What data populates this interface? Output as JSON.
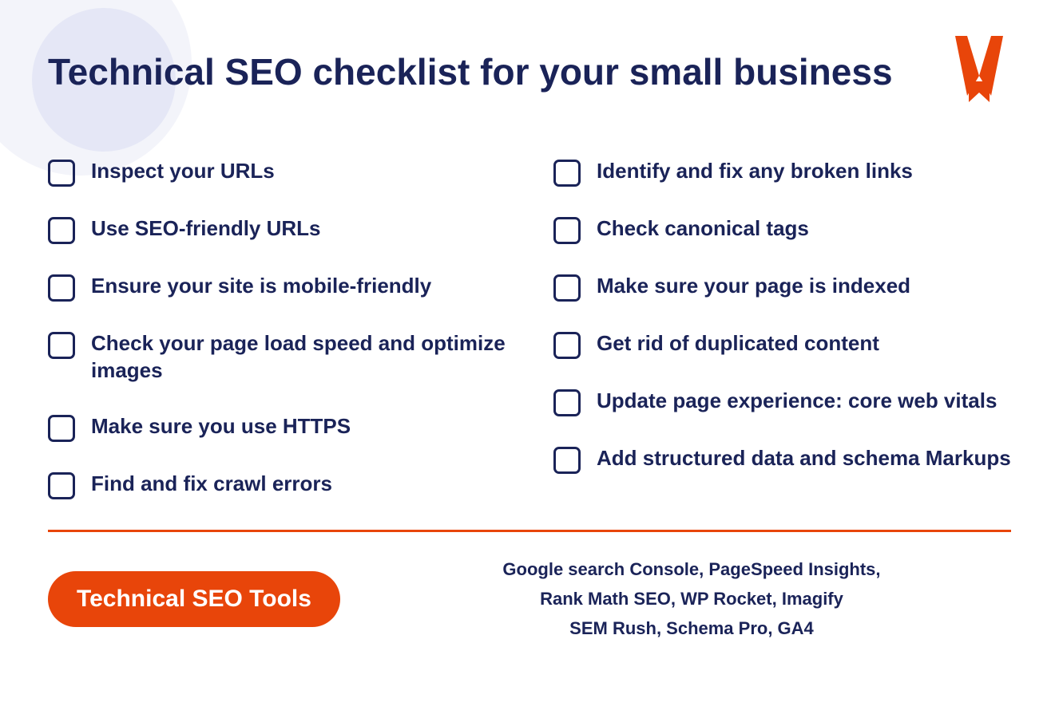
{
  "page": {
    "title": "Technical SEO checklist for your small business",
    "logo_alt": "W logo"
  },
  "checklist": {
    "column1": [
      {
        "id": 1,
        "text": "Inspect your URLs"
      },
      {
        "id": 2,
        "text": "Use SEO-friendly URLs"
      },
      {
        "id": 3,
        "text": "Ensure your site is mobile-friendly"
      },
      {
        "id": 4,
        "text": "Check your page load speed and optimize images"
      },
      {
        "id": 5,
        "text": "Make sure you use HTTPS"
      },
      {
        "id": 6,
        "text": "Find and fix crawl errors"
      }
    ],
    "column2": [
      {
        "id": 7,
        "text": "Identify and fix any broken links"
      },
      {
        "id": 8,
        "text": "Check canonical tags"
      },
      {
        "id": 9,
        "text": "Make sure your page is indexed"
      },
      {
        "id": 10,
        "text": "Get rid of duplicated content"
      },
      {
        "id": 11,
        "text": "Update page experience: core web vitals"
      },
      {
        "id": 12,
        "text": "Add structured data and schema Markups"
      }
    ]
  },
  "footer": {
    "badge_label": "Technical SEO Tools",
    "tools_line1": "Google search Console, PageSpeed Insights,",
    "tools_line2": "Rank Math SEO, WP Rocket, Imagify",
    "tools_line3": "SEM Rush, Schema Pro, GA4"
  }
}
